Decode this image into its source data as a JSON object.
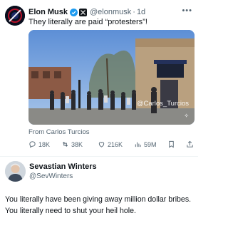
{
  "tweet": {
    "author_name": "Elon Musk",
    "handle": "@elonmusk",
    "time": "1d",
    "separator": "·",
    "text": "They literally are paid “protesters”!",
    "media_watermark": "@Carlos_Turcios",
    "source": "From Carlos Turcios",
    "stats": {
      "replies": "18K",
      "reposts": "38K",
      "likes": "216K",
      "views": "59M"
    }
  },
  "reply": {
    "author_name": "Sevastian Winters",
    "handle": "@SevWinters",
    "text": "You literally have been giving away million dollar bribes. You literally need to shut your heil hole."
  },
  "colors": {
    "verified": "#1d9bf0",
    "secondary_text": "#536471",
    "primary_text": "#0f1419"
  },
  "icons": {
    "more": "more-icon",
    "reply": "reply-icon",
    "repost": "repost-icon",
    "like": "like-icon",
    "views": "views-icon",
    "bookmark": "bookmark-icon",
    "share": "share-icon"
  }
}
